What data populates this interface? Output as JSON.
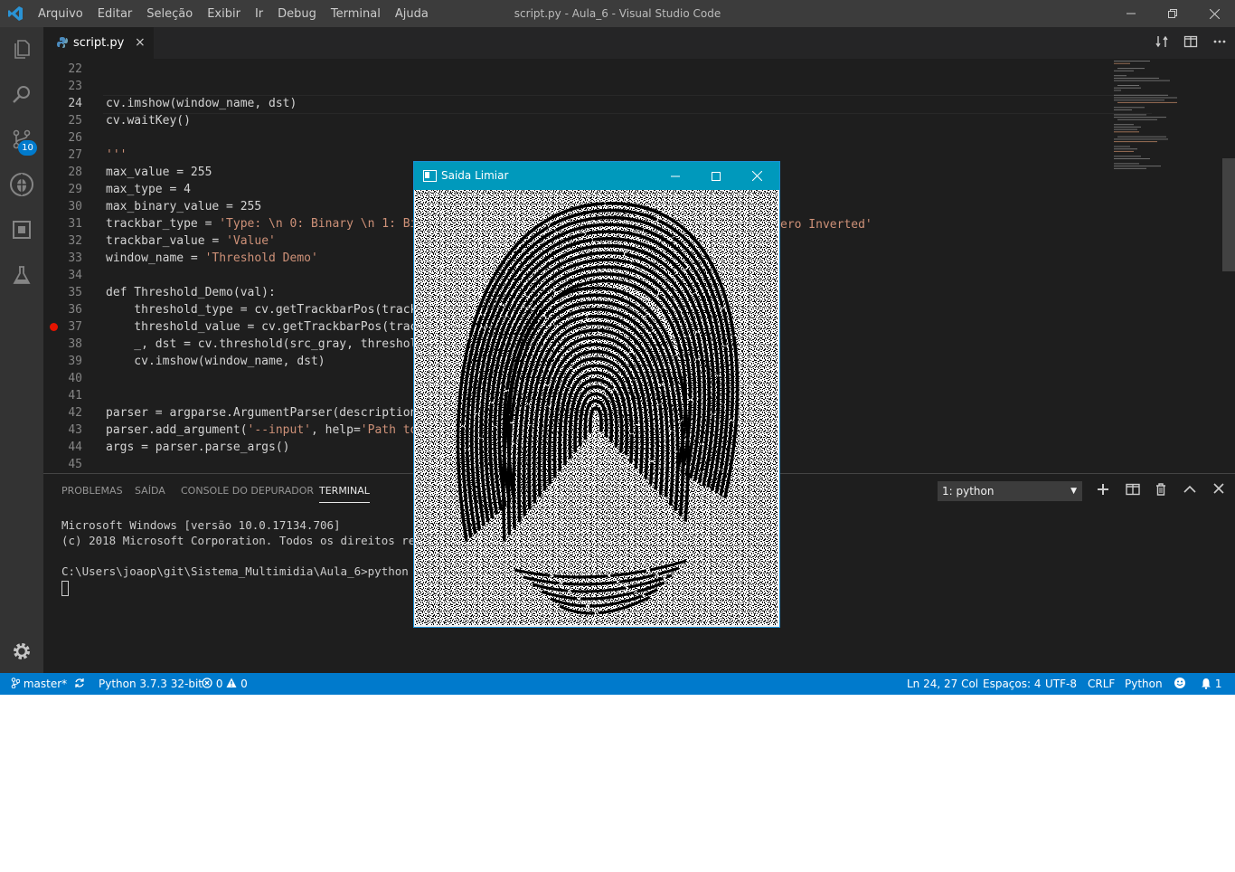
{
  "menu": [
    "Arquivo",
    "Editar",
    "Seleção",
    "Exibir",
    "Ir",
    "Debug",
    "Terminal",
    "Ajuda"
  ],
  "window_title": "script.py - Aula_6 - Visual Studio Code",
  "activity": {
    "scm_badge": "10"
  },
  "tab": {
    "filename": "script.py",
    "close": "×"
  },
  "editor": {
    "lines": [
      {
        "n": "22",
        "code": ""
      },
      {
        "n": "23",
        "code": ""
      },
      {
        "n": "24",
        "code": "cv.imshow(window_name, dst)"
      },
      {
        "n": "25",
        "code": "cv.waitKey()"
      },
      {
        "n": "26",
        "code": ""
      },
      {
        "n": "27",
        "code": "'''"
      },
      {
        "n": "28",
        "code": "max_value = 255"
      },
      {
        "n": "29",
        "code": "max_type = 4"
      },
      {
        "n": "30",
        "code": "max_binary_value = 255"
      },
      {
        "n": "31",
        "code": "trackbar_type = 'Type: \\n 0: Binary \\n 1: Bi"
      },
      {
        "n": "32",
        "code": "trackbar_value = 'Value'"
      },
      {
        "n": "33",
        "code": "window_name = 'Threshold Demo'"
      },
      {
        "n": "34",
        "code": ""
      },
      {
        "n": "35",
        "code": "def Threshold_Demo(val):"
      },
      {
        "n": "36",
        "code": "    threshold_type = cv.getTrackbarPos(track"
      },
      {
        "n": "37",
        "code": "    threshold_value = cv.getTrackbarPos(trac"
      },
      {
        "n": "38",
        "code": "    _, dst = cv.threshold(src_gray, threshol"
      },
      {
        "n": "39",
        "code": "    cv.imshow(window_name, dst)"
      },
      {
        "n": "40",
        "code": ""
      },
      {
        "n": "41",
        "code": ""
      },
      {
        "n": "42",
        "code": "parser = argparse.ArgumentParser(description"
      },
      {
        "n": "43",
        "code": "parser.add_argument('--input', help='Path to"
      },
      {
        "n": "44",
        "code": "args = parser.parse_args()"
      },
      {
        "n": "45",
        "code": ""
      }
    ],
    "line31_tail": "ero Inverted'"
  },
  "panel": {
    "tabs": [
      "PROBLEMAS",
      "SAÍDA",
      "CONSOLE DO DEPURADOR",
      "TERMINAL"
    ],
    "terminal_select": "1: python",
    "terminal_lines": [
      "Microsoft Windows [versão 10.0.17134.706]",
      "(c) 2018 Microsoft Corporation. Todos os direitos reser",
      "",
      "C:\\Users\\joaop\\git\\Sistema_Multimidia\\Aula_6>python scr"
    ]
  },
  "opencv_window": {
    "title": "Saida Limiar"
  },
  "statusbar": {
    "branch": "master*",
    "python": "Python 3.7.3 32-bit",
    "errors": "0",
    "warnings": "0",
    "position": "Ln 24, 27 Col",
    "spaces": "Espaços: 4",
    "encoding": "UTF-8",
    "eol": "CRLF",
    "language": "Python",
    "notifications": "1"
  },
  "colors": {
    "statusbar": "#007acc",
    "titlebar": "#3c3c3c",
    "activitybar": "#333333",
    "editor_bg": "#1e1e1e",
    "cv_titlebar": "#0099bc",
    "breakpoint": "#e51400"
  }
}
